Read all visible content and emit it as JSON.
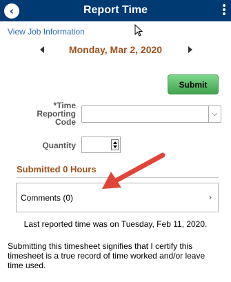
{
  "header": {
    "title": "Report Time",
    "back_icon": "chevron-left-icon",
    "menu_icon": "more-vertical-icon",
    "background_color": "#003a73"
  },
  "job_link": "View Job Information",
  "date_nav": {
    "date": "Monday, Mar 2, 2020",
    "date_color": "#a0521e"
  },
  "submit_label": "Submit",
  "form": {
    "trc_label": "*Time Reporting Code",
    "trc_value": "",
    "quantity_label": "Quantity",
    "quantity_value": ""
  },
  "submitted_hours": "Submitted 0 Hours",
  "comments_label": "Comments (0)",
  "last_reported": "Last reported time was on Tuesday, Feb 11, 2020.",
  "certify_text": "Submitting this timesheet signifies that I certify this timesheet is a true record of time worked and/or leave time used.",
  "annotation_color": "#e0453a"
}
